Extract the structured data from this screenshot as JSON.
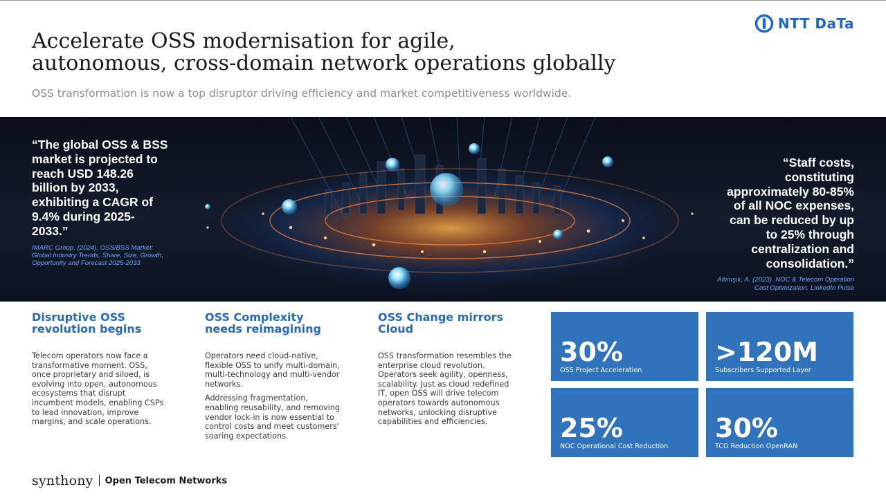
{
  "header": {
    "logo_text": "NTT DaTa",
    "title_line1": "Accelerate OSS modernisation for agile,",
    "title_line2": "autonomous, cross-domain network operations globally",
    "subtitle": "OSS transformation is now a top disruptor driving efficiency and market competitiveness worldwide."
  },
  "hero": {
    "quote_left": "“The global OSS & BSS market is projected to reach USD 148.26 billion by 2033, exhibiting a CAGR of 9.4% during 2025-2033.”",
    "source_left": "IMARC Group. (2024). OSS/BSS Market: Global Industry Trends, Share, Size, Growth, Opportunity and Forecast 2025-2033",
    "quote_right": "“Staff costs, constituting approximately 80-85% of all NOC expenses, can be reduced by up to 25% through centralization and consolidation.”",
    "source_right": "Altınışık, A. (2023). NOC & Telecom Operation Cost Optimization. LinkedIn Pulse"
  },
  "columns": [
    {
      "title": "Disruptive OSS revolution begins",
      "paragraphs": [
        "Telecom operators now face a transformative moment. OSS, once proprietary and siloed, is evolving into open, autonomous ecosystems that disrupt incumbent models, enabling CSPs to lead innovation, improve margins, and scale operations."
      ]
    },
    {
      "title": "OSS Complexity needs reimagining",
      "paragraphs": [
        "Operators need cloud-native, flexible OSS to unify multi-domain, multi-technology and multi-vendor networks.",
        "Addressing fragmentation, enabling reusability, and removing vendor lock-in is now essential to control costs and meet customers' soaring expectations."
      ]
    },
    {
      "title": "OSS Change mirrors Cloud",
      "paragraphs": [
        "OSS transformation resembles the enterprise cloud revolution. Operators seek agility, openness, scalability. Just as cloud redefined IT, open OSS will drive telecom operators towards autonomous networks, unlocking disruptive capabilities and efficiencies."
      ]
    }
  ],
  "stats": [
    {
      "value": "30%",
      "label": "OSS Project Acceleration"
    },
    {
      "value": ">120M",
      "label": "Subscribers Supported Layer"
    },
    {
      "value": "25%",
      "label": "NOC Operational Cost Reduction"
    },
    {
      "value": "30%",
      "label": "TCO Reduction OpenRAN"
    }
  ],
  "footer": {
    "brand": "synthony",
    "tagline": "Open Telecom Networks"
  },
  "colors": {
    "accent_blue": "#3173bb",
    "heading_blue": "#2869b9",
    "logo_blue": "#1f66c7",
    "source_blue": "#6aa8ff"
  }
}
